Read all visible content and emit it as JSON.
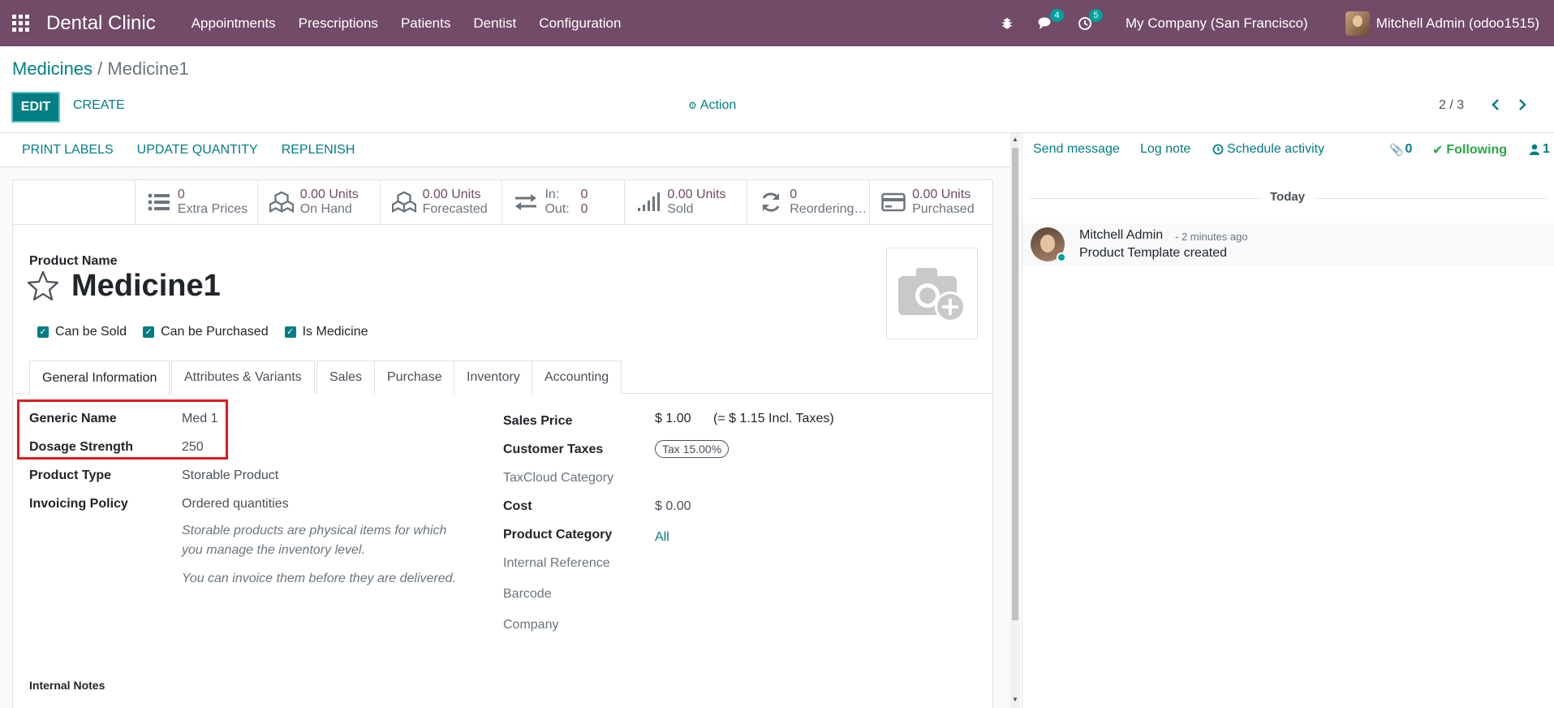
{
  "navbar": {
    "app_name": "Dental Clinic",
    "menu": [
      "Appointments",
      "Prescriptions",
      "Patients",
      "Dentist",
      "Configuration"
    ],
    "messages_count": "4",
    "activities_count": "5",
    "company": "My Company (San Francisco)",
    "user": "Mitchell Admin (odoo1515)"
  },
  "breadcrumb": {
    "parent": "Medicines",
    "separator": "/",
    "current": "Medicine1"
  },
  "controls": {
    "edit": "EDIT",
    "create": "CREATE",
    "action": "Action",
    "pager": "2 / 3"
  },
  "statusbar": {
    "buttons": [
      "PRINT LABELS",
      "UPDATE QUANTITY",
      "REPLENISH"
    ]
  },
  "smart_buttons": [
    {
      "value": "0",
      "label": "Extra Prices",
      "icon": "list-icon"
    },
    {
      "value": "0.00 Units",
      "label": "On Hand",
      "icon": "cubes-icon"
    },
    {
      "value": "0.00 Units",
      "label": "Forecasted",
      "icon": "cubes-icon"
    },
    {
      "in_label": "In:",
      "in_value": "0",
      "out_label": "Out:",
      "out_value": "0",
      "icon": "exchange-icon"
    },
    {
      "value": "0.00 Units",
      "label": "Sold",
      "icon": "signal-icon"
    },
    {
      "value": "0",
      "label": "Reordering…",
      "icon": "refresh-icon"
    },
    {
      "value": "0.00 Units",
      "label": "Purchased",
      "icon": "credit-card-icon"
    }
  ],
  "product": {
    "name_label": "Product Name",
    "name": "Medicine1",
    "checks": [
      "Can be Sold",
      "Can be Purchased",
      "Is Medicine"
    ]
  },
  "tabs": [
    "General Information",
    "Attributes & Variants",
    "Sales",
    "Purchase",
    "Inventory",
    "Accounting"
  ],
  "left_fields": [
    {
      "label": "Generic Name",
      "value": "Med 1"
    },
    {
      "label": "Dosage Strength",
      "value": "250"
    },
    {
      "label": "Product Type",
      "value": "Storable Product"
    },
    {
      "label": "Invoicing Policy",
      "value": "Ordered quantities"
    }
  ],
  "help_text": {
    "line1": "Storable products are physical items for which you manage the inventory level.",
    "line2": "You can invoice them before they are delivered."
  },
  "right_fields": {
    "sales_price_label": "Sales Price",
    "sales_price": "$ 1.00",
    "sales_price_incl": "(= $ 1.15 Incl. Taxes)",
    "customer_taxes_label": "Customer Taxes",
    "customer_tax": "Tax 15.00%",
    "taxcloud_label": "TaxCloud Category",
    "cost_label": "Cost",
    "cost": "$ 0.00",
    "category_label": "Product Category",
    "category": "All",
    "internal_ref_label": "Internal Reference",
    "barcode_label": "Barcode",
    "company_label": "Company"
  },
  "internal_notes_label": "Internal Notes",
  "chatter": {
    "send_message": "Send message",
    "log_note": "Log note",
    "schedule_activity": "Schedule activity",
    "attachments": "0",
    "following": "Following",
    "followers": "1",
    "today": "Today",
    "message": {
      "author": "Mitchell Admin",
      "time": "- 2 minutes ago",
      "body": "Product Template created"
    }
  },
  "colors": {
    "navbar": "#714B67",
    "accent": "#017e84",
    "badge": "#00A09D",
    "highlight": "#e11b1b",
    "following": "#28a745"
  }
}
